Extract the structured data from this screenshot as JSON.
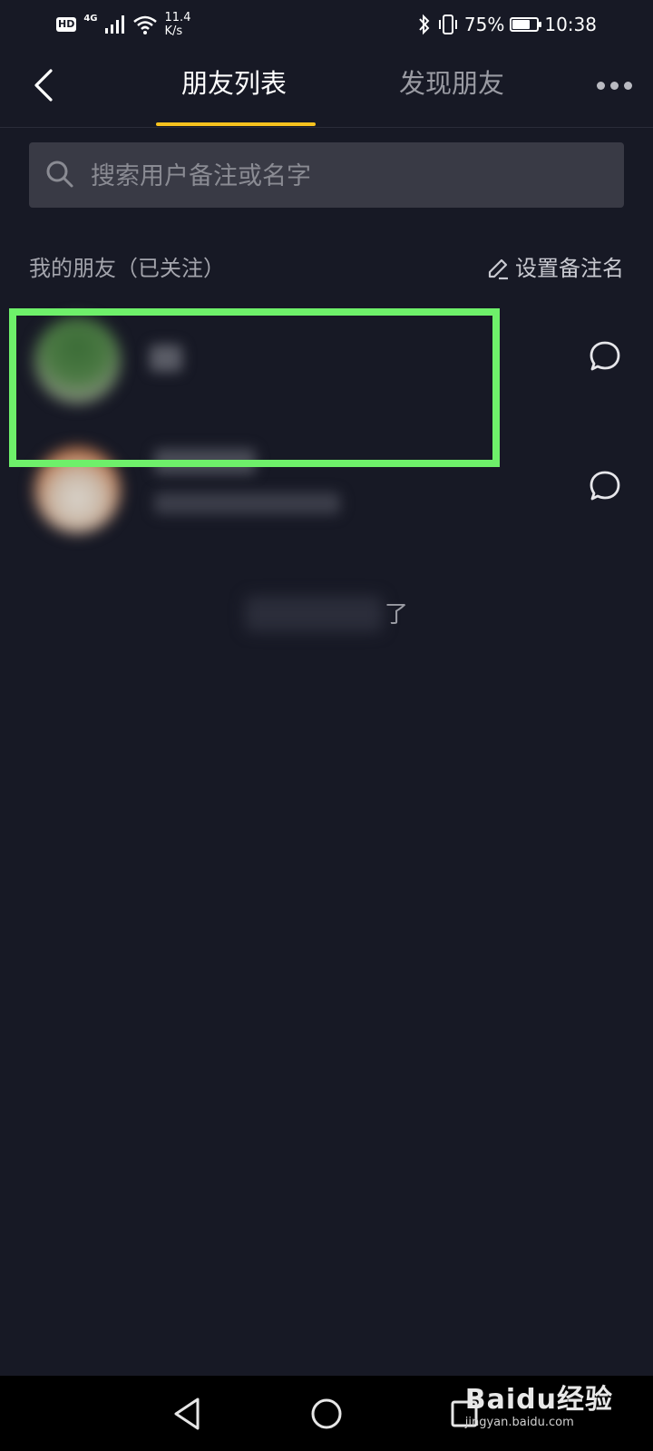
{
  "status_bar": {
    "hd": "HD",
    "network": "4G",
    "speed_value": "11.4",
    "speed_unit": "K/s",
    "battery": "75%",
    "battery_level": 0.75,
    "time": "10:38"
  },
  "header": {
    "tabs": [
      {
        "label": "朋友列表",
        "active": true
      },
      {
        "label": "发现朋友",
        "active": false
      }
    ]
  },
  "search": {
    "placeholder": "搜索用户备注或名字"
  },
  "section": {
    "title": "我的朋友（已关注）",
    "set_remark_label": "设置备注名"
  },
  "end_text": "了",
  "watermark": {
    "main": "Baidu经验",
    "sub": "jingyan.baidu.com"
  },
  "colors": {
    "background": "#171925",
    "accent": "#f7c21e",
    "highlight": "#6ef06a"
  }
}
